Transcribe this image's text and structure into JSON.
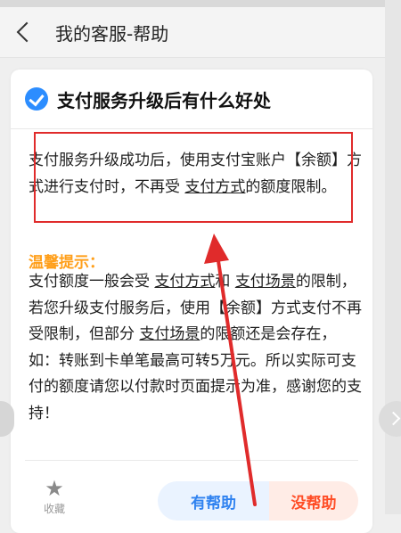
{
  "header": {
    "title": "我的客服-帮助"
  },
  "article": {
    "title": "支付服务升级后有什么好处",
    "para1_a": "支付服务升级成功后，使用支付宝账户【余额】方式进行支付时，不再受 ",
    "para1_link": "支付方式",
    "para1_b": "的额度限制。",
    "tip_title": "温馨提示：",
    "para2_a": "支付额度一般会受 ",
    "para2_link1": "支付方式",
    "para2_b": "和 ",
    "para2_link2": "支付场景",
    "para2_c": "的限制，若您升级支付服务后，使用【余额】方式支付不再受限制，但部分 ",
    "para2_link3": "支付场景",
    "para2_d": "的限额还是会存在，如：转账到卡单笔最高可转5万元。所以实际可支付的额度请您以付款时页面提示为准，感谢您的支持！"
  },
  "footer": {
    "favorite_label": "收藏",
    "helpful_label": "有帮助",
    "not_helpful_label": "没帮助"
  },
  "icons": {
    "back": "chevron-left-icon",
    "check": "check-circle-icon",
    "star": "star-icon"
  },
  "colors": {
    "accent_blue": "#2c8dff",
    "tip_orange": "#ff9f1a",
    "annotation_red": "#e02b2b",
    "not_helpful_red": "#ff4d26"
  }
}
